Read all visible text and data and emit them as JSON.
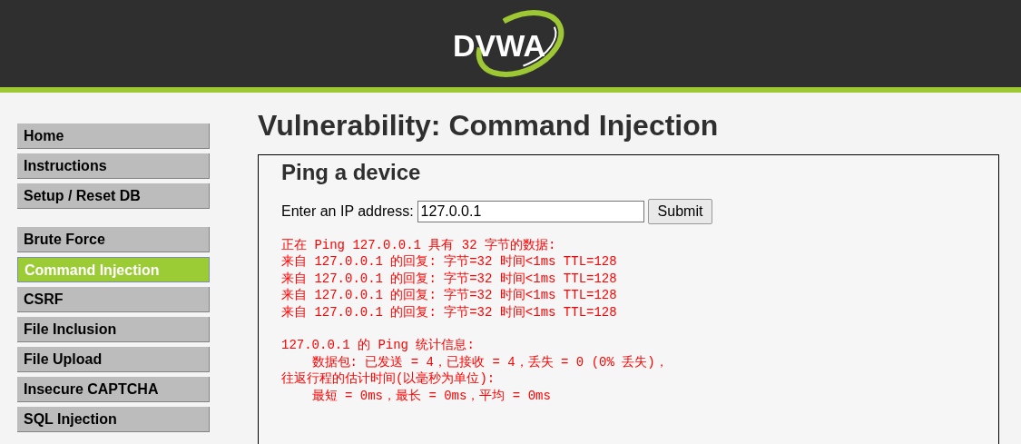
{
  "header": {
    "logo_text": "DVWA"
  },
  "sidebar": {
    "groups": [
      [
        {
          "label": "Home",
          "selected": false
        },
        {
          "label": "Instructions",
          "selected": false
        },
        {
          "label": "Setup / Reset DB",
          "selected": false
        }
      ],
      [
        {
          "label": "Brute Force",
          "selected": false
        },
        {
          "label": "Command Injection",
          "selected": true
        },
        {
          "label": "CSRF",
          "selected": false
        },
        {
          "label": "File Inclusion",
          "selected": false
        },
        {
          "label": "File Upload",
          "selected": false
        },
        {
          "label": "Insecure CAPTCHA",
          "selected": false
        },
        {
          "label": "SQL Injection",
          "selected": false
        }
      ]
    ]
  },
  "main": {
    "title": "Vulnerability: Command Injection",
    "panel": {
      "heading": "Ping a device",
      "field_label": "Enter an IP address:",
      "field_value": "127.0.0.1",
      "button": "Submit",
      "output_blocks": [
        [
          "正在 Ping 127.0.0.1 具有 32 字节的数据:",
          "来自 127.0.0.1 的回复: 字节=32 时间<1ms TTL=128",
          "来自 127.0.0.1 的回复: 字节=32 时间<1ms TTL=128",
          "来自 127.0.0.1 的回复: 字节=32 时间<1ms TTL=128",
          "来自 127.0.0.1 的回复: 字节=32 时间<1ms TTL=128"
        ],
        [
          "127.0.0.1 的 Ping 统计信息:",
          "    数据包: 已发送 = 4，已接收 = 4，丢失 = 0 (0% 丢失)，",
          "往返行程的估计时间(以毫秒为单位):",
          "    最短 = 0ms，最长 = 0ms，平均 = 0ms"
        ]
      ]
    }
  }
}
